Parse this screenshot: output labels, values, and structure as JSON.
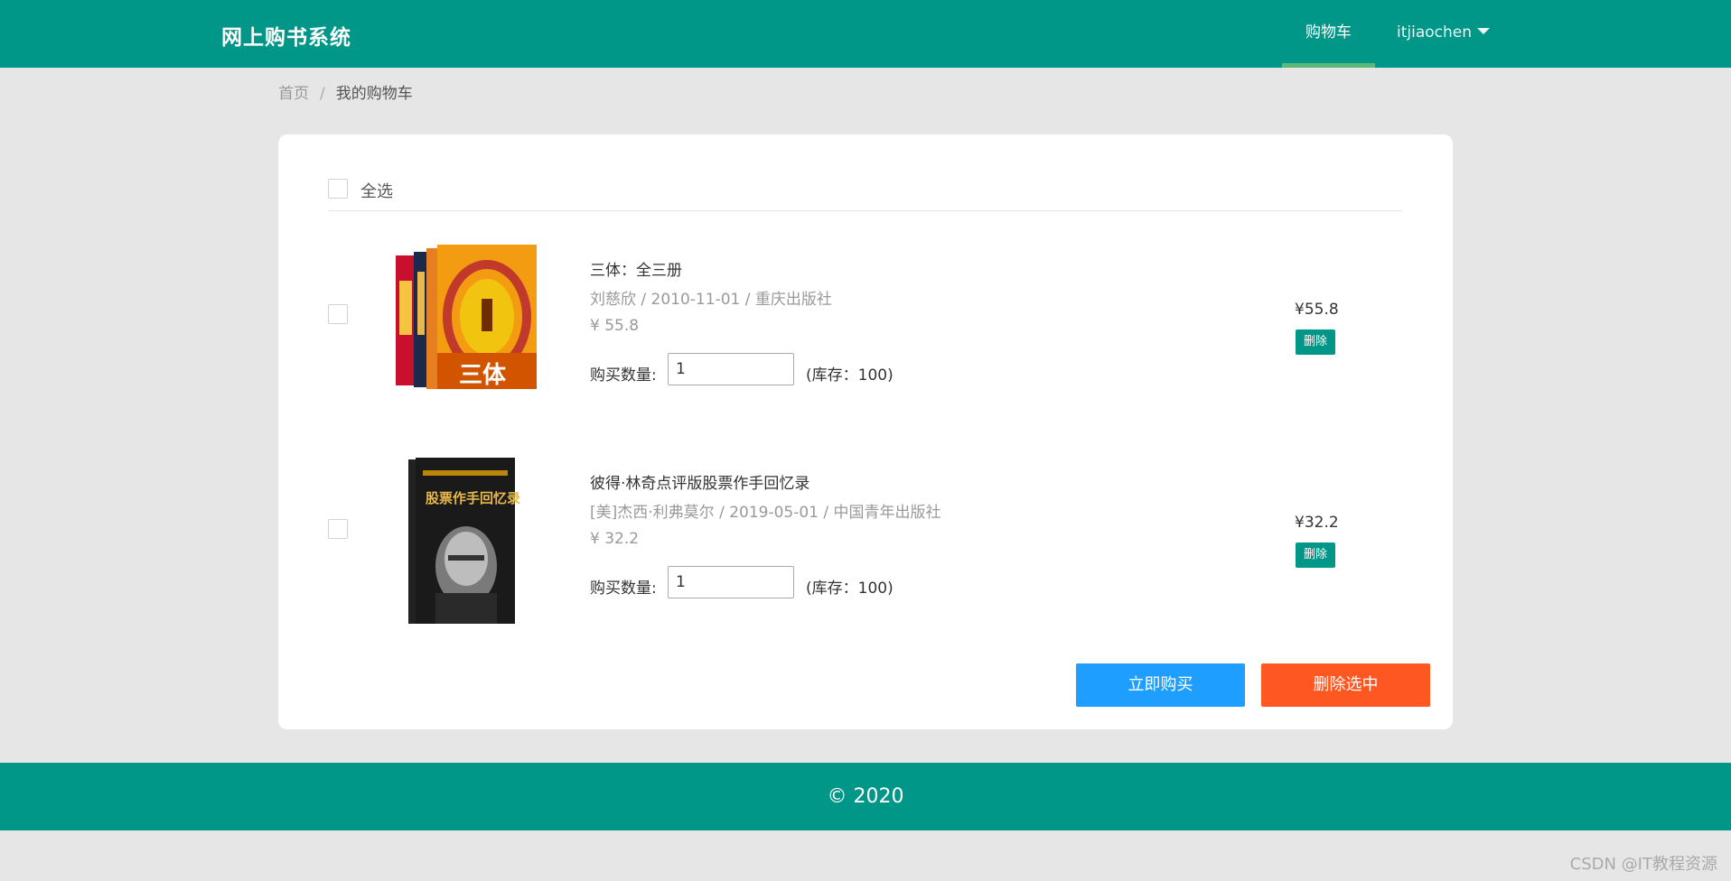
{
  "header": {
    "logo": "网上购书系统",
    "nav_cart": "购物车",
    "nav_user": "itjiaochen",
    "colors": {
      "primary": "#009688",
      "active_underline": "#5fb878"
    }
  },
  "breadcrumb": {
    "home": "首页",
    "separator": "/",
    "current": "我的购物车"
  },
  "cart": {
    "select_all_label": "全选",
    "items": [
      {
        "title": "三体：全三册",
        "meta": "刘慈欣 / 2010-11-01 / 重庆出版社",
        "price": "¥ 55.8",
        "qty_label": "购买数量:",
        "qty_value": "1",
        "stock": "(库存：100)",
        "subtotal": "¥55.8",
        "delete_label": "删除",
        "cover_icon": "book-cover-santi",
        "cover_text": "三体"
      },
      {
        "title": "彼得·林奇点评版股票作手回忆录",
        "meta": "[美]杰西·利弗莫尔 / 2019-05-01 / 中国青年出版社",
        "price": "¥ 32.2",
        "qty_label": "购买数量:",
        "qty_value": "1",
        "stock": "(库存：100)",
        "subtotal": "¥32.2",
        "delete_label": "删除",
        "cover_icon": "book-cover-stock-operator",
        "cover_text": "股票作手回忆录"
      }
    ],
    "buy_label": "立即购买",
    "delete_selected_label": "删除选中",
    "colors": {
      "buy": "#1e9fff",
      "delete_selected": "#ff5722",
      "delete": "#009688"
    }
  },
  "footer": {
    "text": "© 2020"
  },
  "watermark": "CSDN @IT教程资源"
}
